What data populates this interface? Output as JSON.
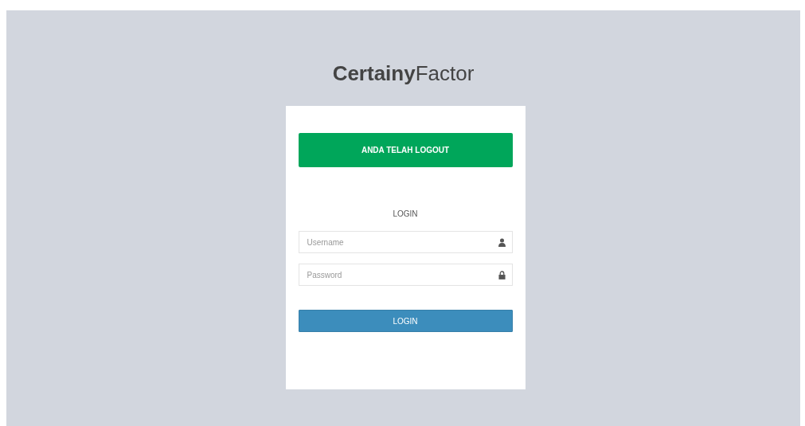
{
  "logo": "**Certainy**Factor",
  "alert": {
    "text": "ANDA TELAH LOGOUT",
    "kind": "success"
  },
  "form_title": "LOGIN",
  "fields": [
    {
      "placeholder": "Username",
      "kind": "user"
    },
    {
      "placeholder": "Password",
      "kind": "password"
    }
  ],
  "submit_button": "LOGIN"
}
